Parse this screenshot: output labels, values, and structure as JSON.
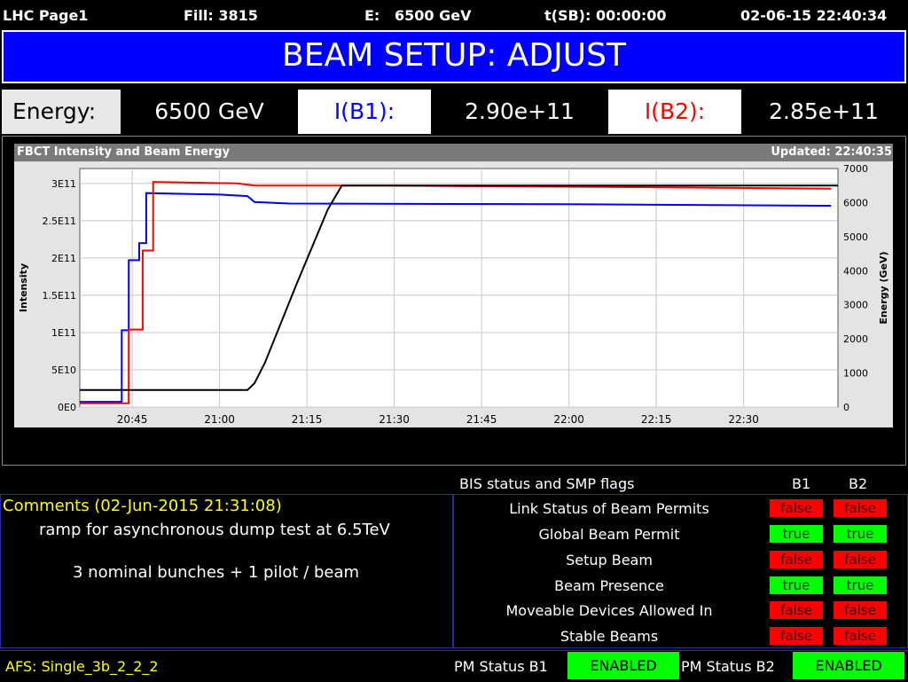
{
  "header": {
    "page": "LHC Page1",
    "fill": "Fill: 3815",
    "energy_label": "E:",
    "energy_value": "6500 GeV",
    "tsb": "t(SB): 00:00:00",
    "datetime": "02-06-15 22:40:34"
  },
  "banner": {
    "mode": "BEAM SETUP: ADJUST"
  },
  "status_row": {
    "energy_label": "Energy:",
    "energy_value": "6500 GeV",
    "ib1_label": "I(B1):",
    "ib1_value": "2.90e+11",
    "ib2_label": "I(B2):",
    "ib2_value": "2.85e+11"
  },
  "chart_header": {
    "title": "FBCT Intensity and Beam Energy",
    "updated": "Updated: 22:40:35"
  },
  "chart_data": {
    "type": "line",
    "ylabel": "Intensity",
    "y2label": "Energy (GeV)",
    "x_tick_labels": [
      "20:45",
      "21:00",
      "21:15",
      "21:30",
      "21:45",
      "22:00",
      "22:15",
      "22:30"
    ],
    "x_range_min": [
      20.6,
      22.77
    ],
    "ylim": [
      0,
      320000000000.0
    ],
    "y_tick_values": [
      0,
      50000000000.0,
      100000000000.0,
      150000000000.0,
      200000000000.0,
      250000000000.0,
      300000000000.0
    ],
    "y_tick_labels": [
      "0E0",
      "5E10",
      "1E11",
      "1.5E11",
      "2E11",
      "2.5E11",
      "3E11"
    ],
    "y2lim": [
      0,
      7000
    ],
    "y2_tick_values": [
      0,
      1000,
      2000,
      3000,
      4000,
      5000,
      6000,
      7000
    ],
    "y2_tick_labels": [
      "0",
      "1000",
      "2000",
      "3000",
      "4000",
      "5000",
      "6000",
      "7000"
    ],
    "grid": true,
    "series": [
      {
        "axis": "left",
        "color": "#0000ff",
        "points": [
          [
            20.6,
            7000000000.0
          ],
          [
            20.72,
            7000000000.0
          ],
          [
            20.72,
            103000000000.0
          ],
          [
            20.74,
            103000000000.0
          ],
          [
            20.74,
            197000000000.0
          ],
          [
            20.77,
            197000000000.0
          ],
          [
            20.77,
            220000000000.0
          ],
          [
            20.79,
            220000000000.0
          ],
          [
            20.79,
            287000000000.0
          ],
          [
            20.9,
            286000000000.0
          ],
          [
            21.0,
            285000000000.0
          ],
          [
            21.08,
            283000000000.0
          ],
          [
            21.1,
            275000000000.0
          ],
          [
            21.2,
            273000000000.0
          ],
          [
            22.0,
            272000000000.0
          ],
          [
            22.75,
            270000000000.0
          ]
        ]
      },
      {
        "axis": "left",
        "color": "#ff0000",
        "points": [
          [
            20.6,
            5000000000.0
          ],
          [
            20.74,
            5000000000.0
          ],
          [
            20.74,
            104000000000.0
          ],
          [
            20.78,
            104000000000.0
          ],
          [
            20.78,
            210000000000.0
          ],
          [
            20.81,
            210000000000.0
          ],
          [
            20.81,
            302000000000.0
          ],
          [
            21.05,
            300000000000.0
          ],
          [
            21.1,
            297000000000.0
          ],
          [
            21.5,
            297000000000.0
          ],
          [
            22.2,
            295000000000.0
          ],
          [
            22.75,
            293000000000.0
          ]
        ]
      },
      {
        "axis": "right",
        "color": "#000000",
        "points": [
          [
            20.6,
            500
          ],
          [
            21.08,
            500
          ],
          [
            21.1,
            700
          ],
          [
            21.13,
            1300
          ],
          [
            21.22,
            3600
          ],
          [
            21.31,
            5800
          ],
          [
            21.35,
            6500
          ],
          [
            22.77,
            6500
          ]
        ]
      }
    ]
  },
  "bis": {
    "header": "BIS status and SMP flags",
    "b1": "B1",
    "b2": "B2",
    "rows": [
      {
        "label": "Link Status of Beam Permits",
        "b1": "false",
        "b2": "false"
      },
      {
        "label": "Global Beam Permit",
        "b1": "true",
        "b2": "true"
      },
      {
        "label": "Setup Beam",
        "b1": "false",
        "b2": "false"
      },
      {
        "label": "Beam Presence",
        "b1": "true",
        "b2": "true"
      },
      {
        "label": "Moveable Devices Allowed In",
        "b1": "false",
        "b2": "false"
      },
      {
        "label": "Stable Beams",
        "b1": "false",
        "b2": "false"
      }
    ]
  },
  "comments": {
    "title": "Comments (02-Jun-2015 21:31:08)",
    "line1": "ramp for asynchronous dump test at 6.5TeV",
    "line2": "3 nominal bunches + 1 pilot / beam"
  },
  "footer": {
    "afs": "AFS: Single_3b_2_2_2",
    "pm_b1_label": "PM Status B1",
    "pm_b1_value": "ENABLED",
    "pm_b2_label": "PM Status B2",
    "pm_b2_value": "ENABLED"
  },
  "colors": {
    "banner": "#0000ff",
    "b1": "#0000ff",
    "b2": "#ff0000",
    "true": "#00ff00",
    "false": "#ff0000",
    "comments": "#ffff00"
  }
}
